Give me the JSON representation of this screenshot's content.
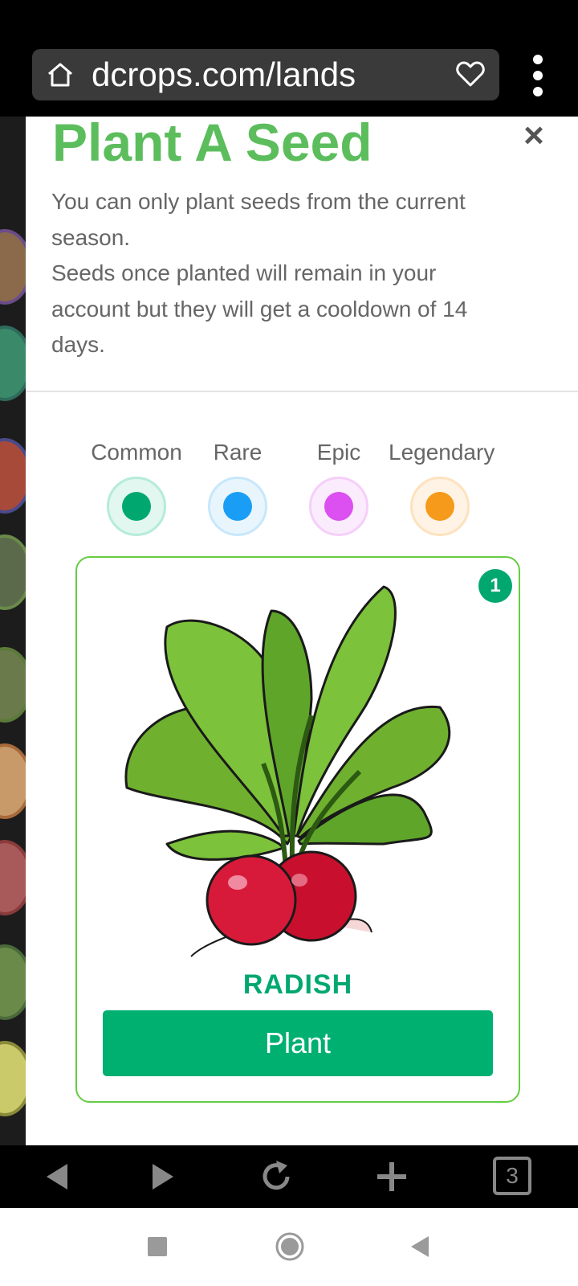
{
  "browser": {
    "url": "dcrops.com/lands",
    "tab_count": "3",
    "icons": [
      "home-icon",
      "heart-icon",
      "menu-icon",
      "back-icon",
      "forward-icon",
      "reload-icon",
      "new-tab-icon"
    ]
  },
  "modal": {
    "title": "Plant A Seed",
    "close_label": "×",
    "description": [
      "You can only plant seeds from the current season.",
      "Seeds once planted will remain in your account but they will get a cooldown of 14 days."
    ]
  },
  "rarities": [
    {
      "label": "Common",
      "color": "#00a870",
      "ring": "#b5ecd7"
    },
    {
      "label": "Rare",
      "color": "#1a9ef5",
      "ring": "#c7e7fb"
    },
    {
      "label": "Epic",
      "color": "#dc4ff0",
      "ring": "#f5cff9"
    },
    {
      "label": "Legendary",
      "color": "#f59a1b",
      "ring": "#fde2bd"
    }
  ],
  "seed_card": {
    "count": "1",
    "name": "RADISH",
    "button_label": "Plant",
    "accent": "#00b070",
    "border": "#66cc44"
  },
  "system_nav": {
    "icons": [
      "recents-square-icon",
      "home-circle-icon",
      "back-triangle-icon"
    ]
  }
}
